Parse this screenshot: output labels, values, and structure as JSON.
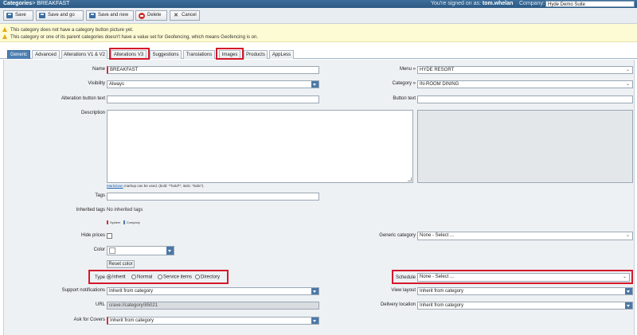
{
  "header": {
    "breadcrumb": "Categories",
    "current": "> BREAKFAST",
    "signed_in_label": "You're signed on as:",
    "user": "tom.whelan",
    "company_label": "Company:",
    "company_value": "Hyde Demo Suite"
  },
  "toolbar": {
    "save": "Save",
    "save_and_go": "Save and go",
    "save_and_new": "Save and new",
    "delete": "Delete",
    "cancel": "Cancel"
  },
  "notices": [
    "This category does not have a category button picture yet.",
    "This category or one of its parent categories doesn't have a value set for Geofencing, which means Geofencing is on."
  ],
  "tabs": [
    "Generic",
    "Advanced",
    "Alterations V1 & V2",
    "Alterations V3",
    "Suggestions",
    "Translations",
    "Images",
    "Products",
    "AppLess"
  ],
  "form": {
    "name_label": "Name",
    "name_value": "BREAKFAST",
    "menu_label": "Menu",
    "menu_value": "HYDE RESORT",
    "visibility_label": "Visibility",
    "visibility_value": "Always",
    "category_label": "Category",
    "category_value": "IN-ROOM DINING",
    "alteration_button_label": "Alteration button text",
    "button_text_label": "Button text",
    "description_label": "Description",
    "markdown_link": "Markdown",
    "markdown_help": " markup can be used. (bold: **bold**, italic: *italic*).",
    "tags_label": "Tags",
    "inherited_tags_label": "Inherited tags",
    "inherited_tags_value": "No inherited tags",
    "legend_system": "System",
    "legend_company": "Company",
    "hide_prices_label": "Hide prices",
    "generic_category_label": "Generic category",
    "generic_category_value": "None - Select ...",
    "color_label": "Color",
    "reset_color": "Reset color",
    "type_label": "Type",
    "type_options": [
      "Inherit",
      "Normal",
      "Service items",
      "Directory"
    ],
    "schedule_label": "Schedule",
    "schedule_value": "None - Select ...",
    "support_notifications_label": "Support notifications",
    "support_notifications_value": "Inherit from category",
    "view_layout_label": "View layout",
    "view_layout_value": "Inherit from category",
    "url_label": "URL",
    "url_value": "crave://category/85021",
    "delivery_location_label": "Delivery location",
    "delivery_location_value": "Inherit from category",
    "ask_for_covers_label": "Ask for Covers",
    "ask_for_covers_value": "Inherit from category"
  },
  "colors": {
    "header_bg": "#2b5a85",
    "active_tab": "#4d7fb3",
    "highlight": "#d4192b",
    "notice_bg": "#fcfbd3",
    "required_marker": "#c9303f",
    "legend_company": "#4b78a7"
  }
}
